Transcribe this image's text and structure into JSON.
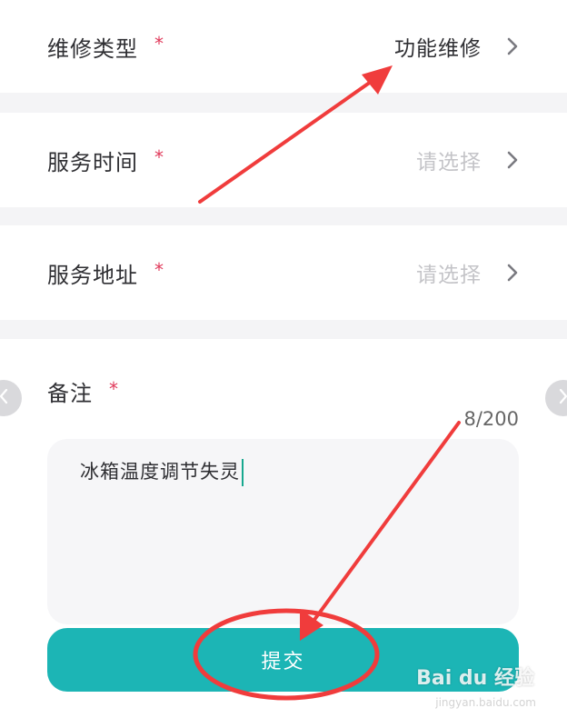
{
  "form": {
    "repair_type": {
      "label": "维修类型",
      "required_mark": "*",
      "value": "功能维修"
    },
    "service_time": {
      "label": "服务时间",
      "required_mark": "*",
      "placeholder": "请选择"
    },
    "service_address": {
      "label": "服务地址",
      "required_mark": "*",
      "placeholder": "请选择"
    },
    "remark": {
      "label": "备注",
      "required_mark": "*",
      "value": "冰箱温度调节失灵",
      "counter": "8/200"
    },
    "submit_label": "提交"
  },
  "watermark": {
    "brand": "Bai du 经验",
    "site": "jingyan.baidu.com"
  },
  "colors": {
    "accent": "#1cb5b5",
    "required": "#e0395a",
    "annotation": "#f03c3c"
  },
  "icons": {
    "row_chevron": "chevron-right-icon",
    "side_prev": "chevron-left-icon",
    "side_next": "chevron-right-icon"
  }
}
